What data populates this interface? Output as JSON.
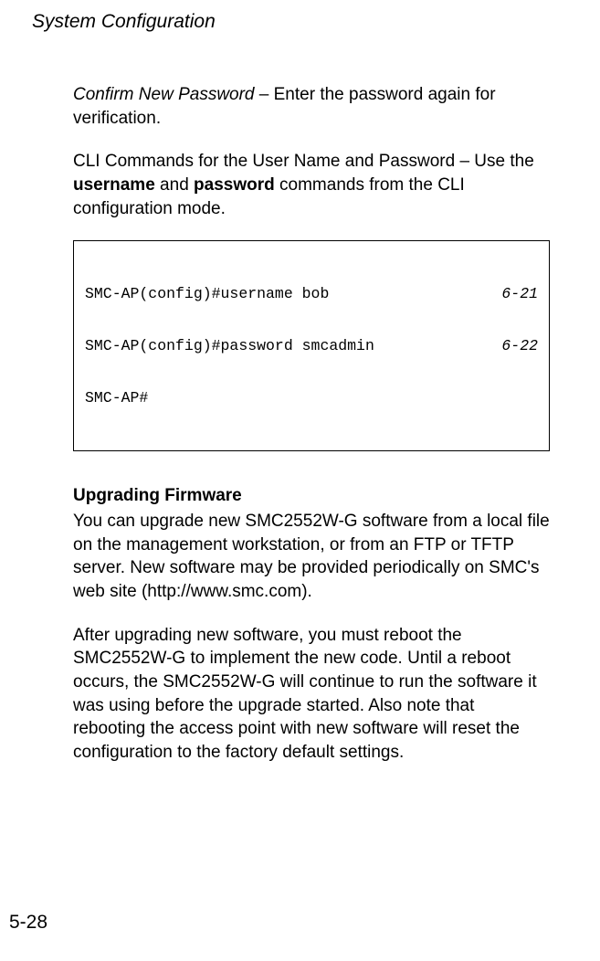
{
  "header": {
    "title": "System Configuration"
  },
  "section1": {
    "label": "Confirm New Password",
    "separator": " – ",
    "text": "Enter the password again for verification."
  },
  "section2": {
    "intro": "CLI Commands for the User Name and Password – Use the ",
    "cmd1": "username",
    "mid1": " and ",
    "cmd2": "password",
    "tail": " commands from the CLI configuration mode."
  },
  "codebox": {
    "lines": [
      {
        "text": "SMC-AP(config)#username bob",
        "ref": "6-21"
      },
      {
        "text": "SMC-AP(config)#password smcadmin",
        "ref": "6-22"
      },
      {
        "text": "SMC-AP#",
        "ref": ""
      }
    ]
  },
  "section3": {
    "heading": "Upgrading Firmware",
    "p1": "You can upgrade new SMC2552W-G software from a local file on the management workstation, or from an FTP or TFTP server. New software may be provided periodically on SMC's web site (http://www.smc.com).",
    "p2": "After upgrading new software, you must reboot the SMC2552W-G to implement the new code. Until a reboot occurs, the SMC2552W-G will continue to run the software it was using before the upgrade started. Also note that rebooting the access point with new software will reset the configuration to the factory default settings."
  },
  "footer": {
    "pageNumber": "5-28"
  }
}
